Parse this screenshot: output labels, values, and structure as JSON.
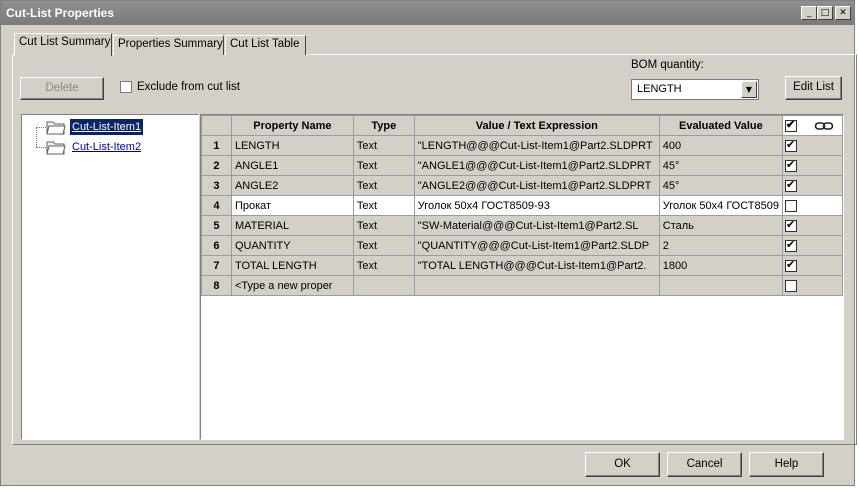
{
  "window": {
    "title": "Cut-List Properties"
  },
  "caption": {
    "min": "_",
    "max": "□",
    "close": "✕"
  },
  "tabs": [
    {
      "label": "Cut List Summary",
      "active": true
    },
    {
      "label": "Properties Summary",
      "active": false
    },
    {
      "label": "Cut List Table",
      "active": false
    }
  ],
  "toolbar": {
    "delete_label": "Delete",
    "exclude_label": "Exclude from cut list",
    "exclude_checked": false,
    "bom_label": "BOM quantity:",
    "bom_value": "LENGTH",
    "edit_list_label": "Edit List"
  },
  "tree": {
    "items": [
      {
        "label": "Cut-List-Item1",
        "selected": true
      },
      {
        "label": "Cut-List-Item2",
        "selected": false
      }
    ]
  },
  "grid": {
    "headers": {
      "property_name": "Property Name",
      "type": "Type",
      "value": "Value / Text Expression",
      "evaluated": "Evaluated Value"
    },
    "header_check": true,
    "link_icon": "link-icon",
    "rows": [
      {
        "num": "1",
        "name": "LENGTH",
        "type": "Text",
        "value": "\"LENGTH@@@Cut-List-Item1@Part2.SLDPRT",
        "evaluated": "400",
        "linked": true,
        "style": "grey"
      },
      {
        "num": "2",
        "name": "ANGLE1",
        "type": "Text",
        "value": "\"ANGLE1@@@Cut-List-Item1@Part2.SLDPRT",
        "evaluated": "45°",
        "linked": true,
        "style": "grey"
      },
      {
        "num": "3",
        "name": "ANGLE2",
        "type": "Text",
        "value": "\"ANGLE2@@@Cut-List-Item1@Part2.SLDPRT",
        "evaluated": "45°",
        "linked": true,
        "style": "grey"
      },
      {
        "num": "4",
        "name": "Прокат",
        "type": "Text",
        "value": "Уголок 50x4 ГОСТ8509-93",
        "evaluated": "Уголок 50x4 ГОСТ8509",
        "linked": false,
        "style": "white"
      },
      {
        "num": "5",
        "name": "MATERIAL",
        "type": "Text",
        "value": "\"SW-Material@@@Cut-List-Item1@Part2.SL",
        "evaluated": "Сталь",
        "linked": true,
        "style": "grey"
      },
      {
        "num": "6",
        "name": "QUANTITY",
        "type": "Text",
        "value": "\"QUANTITY@@@Cut-List-Item1@Part2.SLDP",
        "evaluated": "2",
        "linked": true,
        "style": "grey"
      },
      {
        "num": "7",
        "name": "TOTAL LENGTH",
        "type": "Text",
        "value": "\"TOTAL LENGTH@@@Cut-List-Item1@Part2.",
        "evaluated": "1800",
        "linked": true,
        "style": "grey"
      },
      {
        "num": "8",
        "name": "<Type a new proper",
        "type": "",
        "value": "",
        "evaluated": "",
        "linked": false,
        "style": "grey"
      }
    ]
  },
  "footer": {
    "ok_label": "OK",
    "cancel_label": "Cancel",
    "help_label": "Help"
  }
}
